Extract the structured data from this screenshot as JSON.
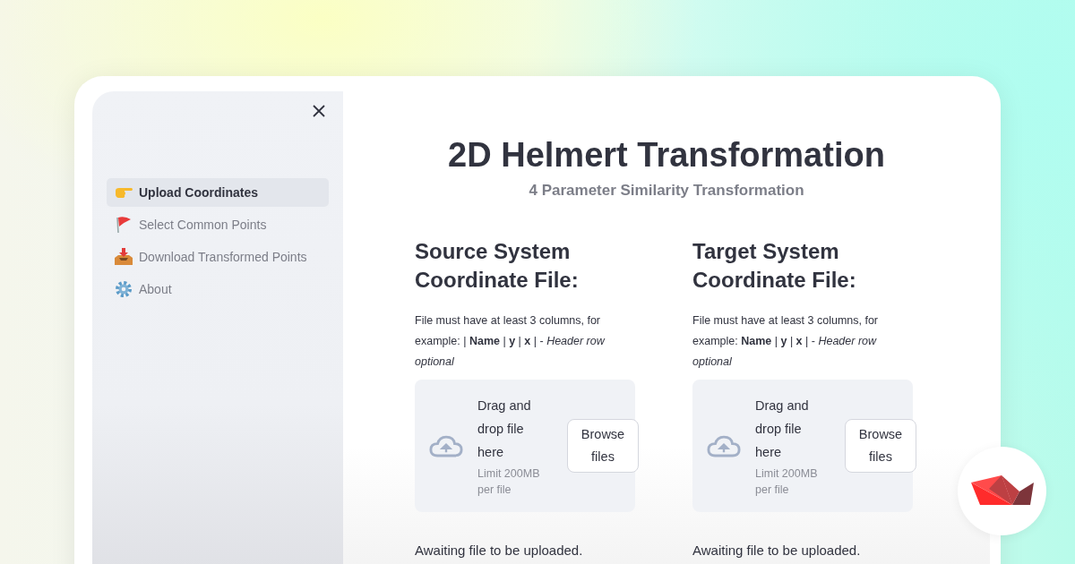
{
  "sidebar": {
    "items": [
      {
        "label": "Upload Coordinates",
        "selected": true,
        "kind": "pointing"
      },
      {
        "label": "Select Common Points",
        "selected": false,
        "kind": "flag"
      },
      {
        "label": "Download Transformed Points",
        "selected": false,
        "kind": "tray"
      },
      {
        "label": "About",
        "selected": false,
        "kind": "gear"
      }
    ]
  },
  "main": {
    "title": "2D Helmert Transformation",
    "subtitle": "4 Parameter Similarity Transformation",
    "uploaders": [
      {
        "heading": "Source System Coordinate File:",
        "requirement": "File must have at least 3 columns, for example:  | **Name** | **y** | **x** |  -  *Header row optional*",
        "drop_label": "Drag and drop file here",
        "limit": "Limit 200MB per file",
        "button": "Browse files",
        "status": "Awaiting file to be uploaded."
      },
      {
        "heading": "Target System Coordinate File:",
        "requirement": "File must have at least 3 columns, for example: **Name** | **y** | **x** |  -  *Header row optional*",
        "drop_label": "Drag and drop file here",
        "limit": "Limit 200MB per file",
        "button": "Browse files",
        "status": "Awaiting file to be uploaded."
      }
    ]
  }
}
